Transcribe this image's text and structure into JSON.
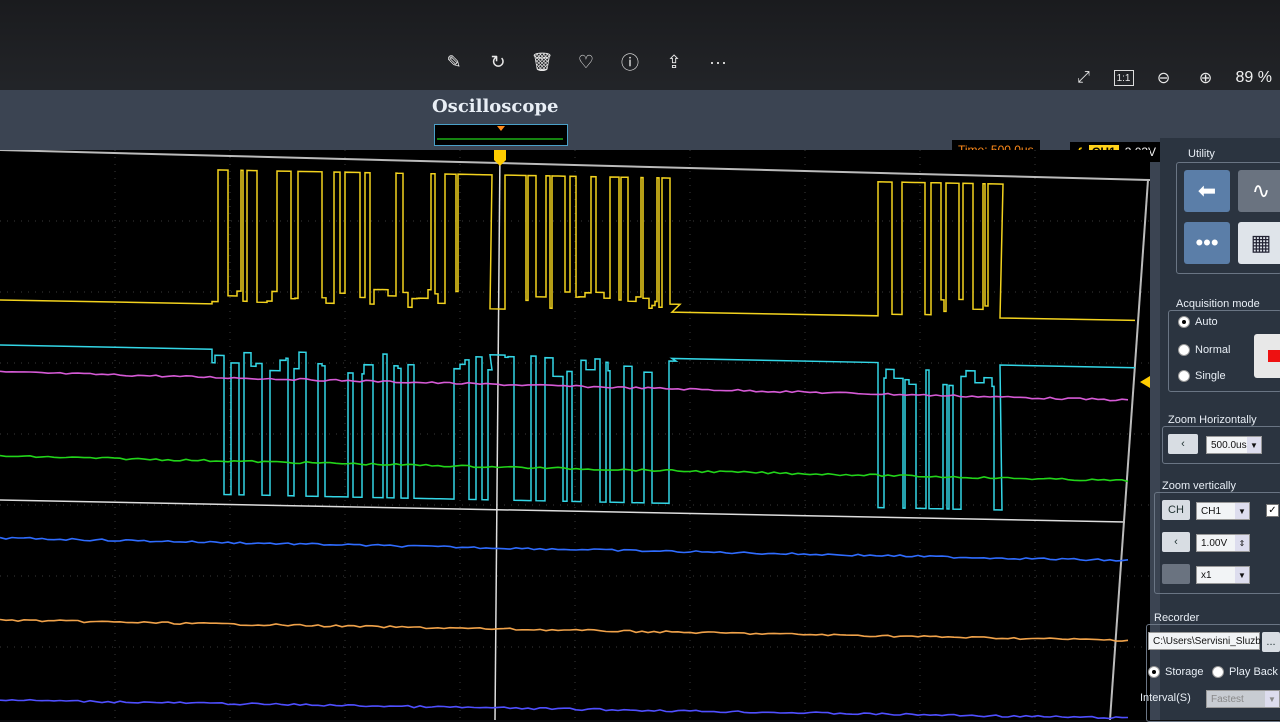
{
  "viewer": {
    "toolbar": [
      {
        "name": "edit-icon",
        "glyph": "✎"
      },
      {
        "name": "rotate-icon",
        "glyph": "↻"
      },
      {
        "name": "delete-icon",
        "glyph": "🗑"
      },
      {
        "name": "favorite-icon",
        "glyph": "♡"
      },
      {
        "name": "info-icon",
        "glyph": "ⓘ"
      },
      {
        "name": "share-icon",
        "glyph": "⇪"
      },
      {
        "name": "more-icon",
        "glyph": "···"
      }
    ],
    "right_tools": [
      {
        "name": "fullscreen-icon",
        "glyph": "⤢"
      },
      {
        "name": "actual-size-icon",
        "glyph": "1:1"
      },
      {
        "name": "zoom-out-icon",
        "glyph": "⊖"
      },
      {
        "name": "zoom-in-icon",
        "glyph": "⊕"
      }
    ],
    "zoom_level": "89 %"
  },
  "scope": {
    "title": "Oscilloscope",
    "time_readout": "Time: 500.0us",
    "trigger": {
      "edge": "ƒ",
      "channel": "CH1",
      "level": "3.03V"
    },
    "channel_colors": {
      "ch1": "#f2d21e",
      "ch2": "#33d6e6",
      "ch3": "#d65ad6",
      "ch4": "#22d41a",
      "ch5": "#2f6cff",
      "ch6": "#f0a24a",
      "ch7": "#4f4fff"
    }
  },
  "panel": {
    "utility_title": "Utility",
    "acquisition_title": "Acquisition mode",
    "modes": [
      "Auto",
      "Normal",
      "Single"
    ],
    "selected_mode": "Auto",
    "zoom_h_title": "Zoom Horizontally",
    "zoom_h_value": "500.0us",
    "zoom_v_title": "Zoom vertically",
    "ch_button": "CH",
    "ch_value": "CH1",
    "volt_value": "1.00V",
    "probe_value": "x1",
    "recorder_title": "Recorder",
    "recorder_path": "C:\\Users\\Servisni_Sluzb",
    "recorder_browse": "...",
    "storage_label": "Storage",
    "playback_label": "Play Back",
    "interval_label": "Interval(S)",
    "interval_value": "Fastest"
  }
}
